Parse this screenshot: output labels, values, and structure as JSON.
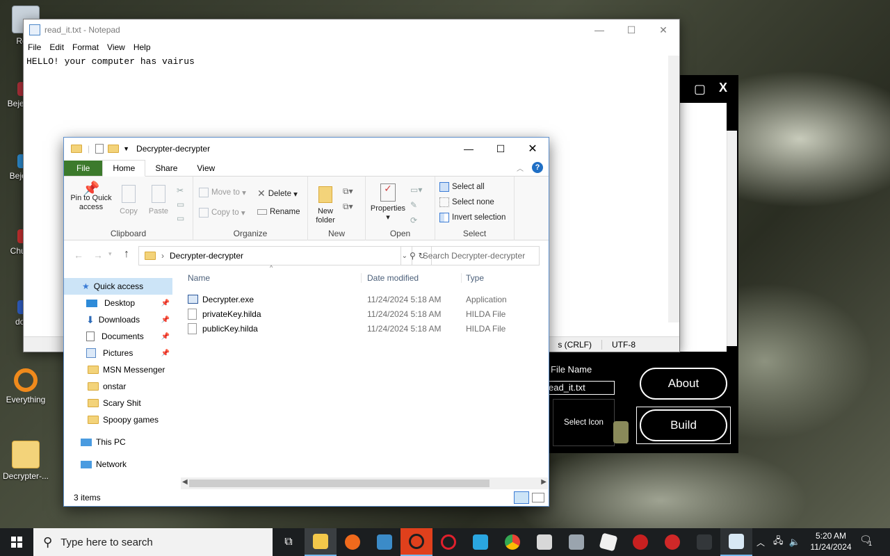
{
  "desktop": {
    "icons": [
      {
        "label": "Recy",
        "icon": "recycle-bin-icon"
      },
      {
        "label": "Bejev De",
        "icon": "game-icon"
      },
      {
        "label": "Beje De",
        "icon": "game-icon"
      },
      {
        "label": "Chu De",
        "icon": "app-icon"
      },
      {
        "label": "does",
        "icon": "app-icon"
      },
      {
        "label": "Everything",
        "icon": "search-app-icon"
      },
      {
        "label": "Decrypter-...",
        "icon": "zip-folder-icon"
      }
    ]
  },
  "notepad": {
    "title": "read_it.txt - Notepad",
    "menu": [
      "File",
      "Edit",
      "Format",
      "View",
      "Help"
    ],
    "content": "HELLO! your computer has vairus",
    "status_line_ending": "s (CRLF)",
    "status_encoding": "UTF-8"
  },
  "builder": {
    "file_name_label": "File Name",
    "file_name_value": "ead_it.txt",
    "select_icon_label": "Select Icon",
    "about_label": "About",
    "build_label": "Build",
    "maximize_glyph": "▢",
    "close_glyph": "X"
  },
  "explorer": {
    "title": "Decrypter-decrypter",
    "tabs": {
      "file": "File",
      "home": "Home",
      "share": "Share",
      "view": "View"
    },
    "ribbon": {
      "clipboard": {
        "label": "Clipboard",
        "pin": "Pin to Quick access",
        "copy": "Copy",
        "paste": "Paste"
      },
      "organize": {
        "label": "Organize",
        "move_to": "Move to",
        "copy_to": "Copy to",
        "delete": "Delete",
        "rename": "Rename"
      },
      "new": {
        "label": "New",
        "new_folder": "New folder"
      },
      "open": {
        "label": "Open",
        "properties": "Properties"
      },
      "select": {
        "label": "Select",
        "select_all": "Select all",
        "select_none": "Select none",
        "invert": "Invert selection"
      }
    },
    "address": {
      "path": "Decrypter-decrypter",
      "search_placeholder": "Search Decrypter-decrypter"
    },
    "nav": {
      "quick_access": "Quick access",
      "items": [
        "Desktop",
        "Downloads",
        "Documents",
        "Pictures",
        "MSN Messenger",
        "onstar",
        "Scary Shit",
        "Spoopy games"
      ],
      "this_pc": "This PC",
      "network": "Network"
    },
    "columns": {
      "name": "Name",
      "date": "Date modified",
      "type": "Type"
    },
    "files": [
      {
        "name": "Decrypter.exe",
        "date": "11/24/2024 5:18 AM",
        "type": "Application"
      },
      {
        "name": "privateKey.hilda",
        "date": "11/24/2024 5:18 AM",
        "type": "HILDA File"
      },
      {
        "name": "publicKey.hilda",
        "date": "11/24/2024 5:18 AM",
        "type": "HILDA File"
      }
    ],
    "status": "3 items"
  },
  "taskbar": {
    "search_placeholder": "Type here to search",
    "time": "5:20 AM",
    "date": "11/24/2024",
    "notification_count": "1"
  }
}
